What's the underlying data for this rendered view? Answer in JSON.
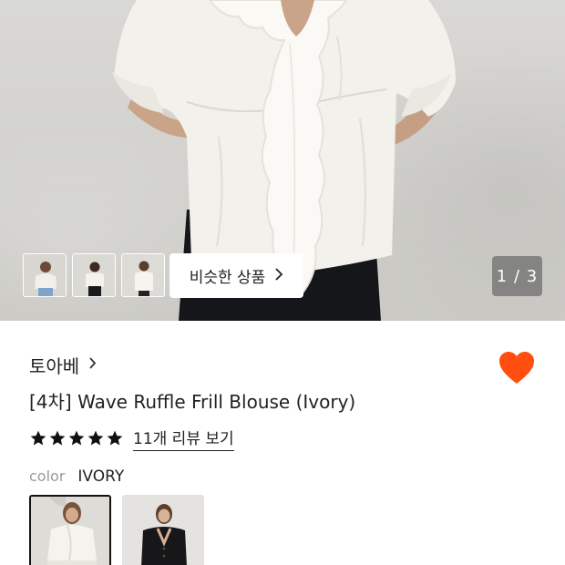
{
  "gallery": {
    "similar_button_label": "비슷한 상품",
    "pager_text": "1 / 3",
    "thumbnails": [
      "thumbnail-1",
      "thumbnail-2",
      "thumbnail-3"
    ]
  },
  "product": {
    "brand": "토아베",
    "title": "[4차] Wave Ruffle Frill Blouse (Ivory)",
    "rating_stars": 5,
    "review_link": "11개 리뷰 보기",
    "color_label": "color",
    "color_value": "IVORY",
    "swatches": [
      {
        "name": "IVORY",
        "selected": true
      },
      {
        "name": "BLACK",
        "selected": false
      }
    ]
  },
  "colors": {
    "accent_heart": "#ff4e0f",
    "star": "#111111"
  }
}
